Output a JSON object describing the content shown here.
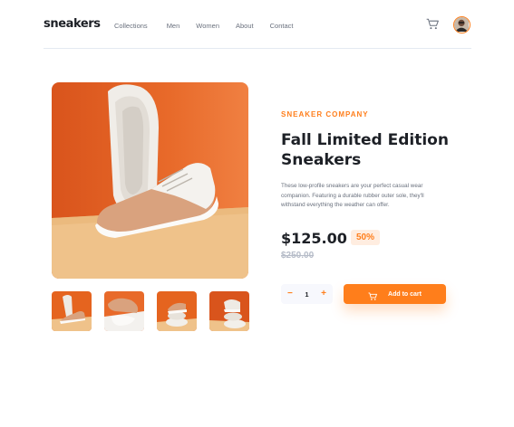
{
  "header": {
    "logo": "sneakers",
    "nav": [
      "Collections",
      "Men",
      "Women",
      "About",
      "Contact"
    ]
  },
  "product": {
    "company": "SNEAKER COMPANY",
    "title": "Fall Limited Edition Sneakers",
    "description": "These low-profile sneakers are your perfect casual wear companion. Featuring a durable rubber outer sole, they'll withstand everything the weather can offer.",
    "price": "$125.00",
    "discount": "50%",
    "old_price": "$250.00"
  },
  "cart": {
    "minus": "−",
    "quantity": "1",
    "plus": "+",
    "add_label": "Add to cart"
  },
  "colors": {
    "accent": "#ff7e1b",
    "accent_pale": "#ffede0",
    "text_dark": "#1d2026",
    "text_muted": "#69707d"
  },
  "icons": {
    "cart": "cart-icon",
    "avatar": "avatar"
  }
}
